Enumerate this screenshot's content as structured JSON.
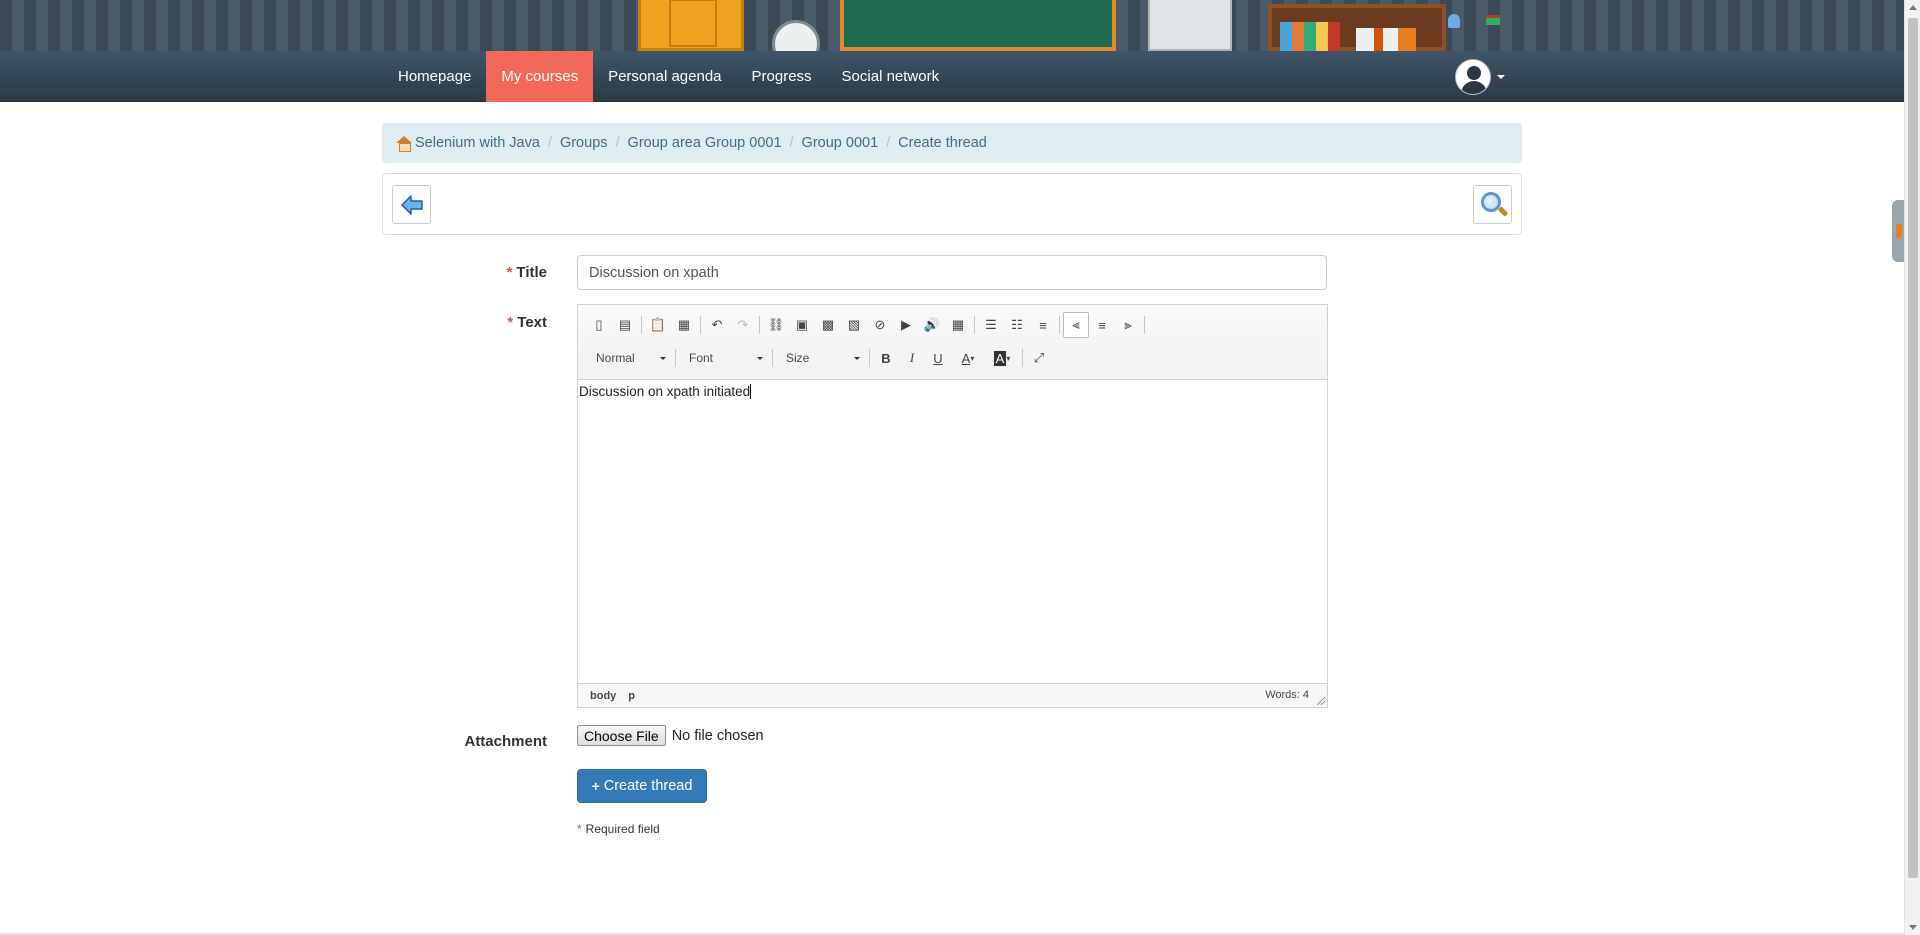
{
  "nav": {
    "items": [
      "Homepage",
      "My courses",
      "Personal agenda",
      "Progress",
      "Social network"
    ],
    "active": "My courses"
  },
  "breadcrumb": [
    "Selenium with Java",
    "Groups",
    "Group area Group 0001",
    "Group 0001",
    "Create thread"
  ],
  "form": {
    "title_label": "Title",
    "title_value": "Discussion on xpath",
    "text_label": "Text",
    "attachment_label": "Attachment",
    "file_button": "Choose File",
    "file_status": "No file chosen",
    "submit_label": "Create thread",
    "required_note": "Required field",
    "required_mark": "*"
  },
  "editor": {
    "format": "Normal",
    "font": "Font",
    "size": "Size",
    "content": "Discussion on xpath initiated",
    "path": [
      "body",
      "p"
    ],
    "word_count": "Words: 4"
  },
  "colors": {
    "nav_active": "#f2695a",
    "navbar": "#34495e",
    "breadcrumb_bg": "#dfecf0",
    "link": "#3d6f8b",
    "primary_button": "#337ab7",
    "required": "#e74c3c"
  }
}
